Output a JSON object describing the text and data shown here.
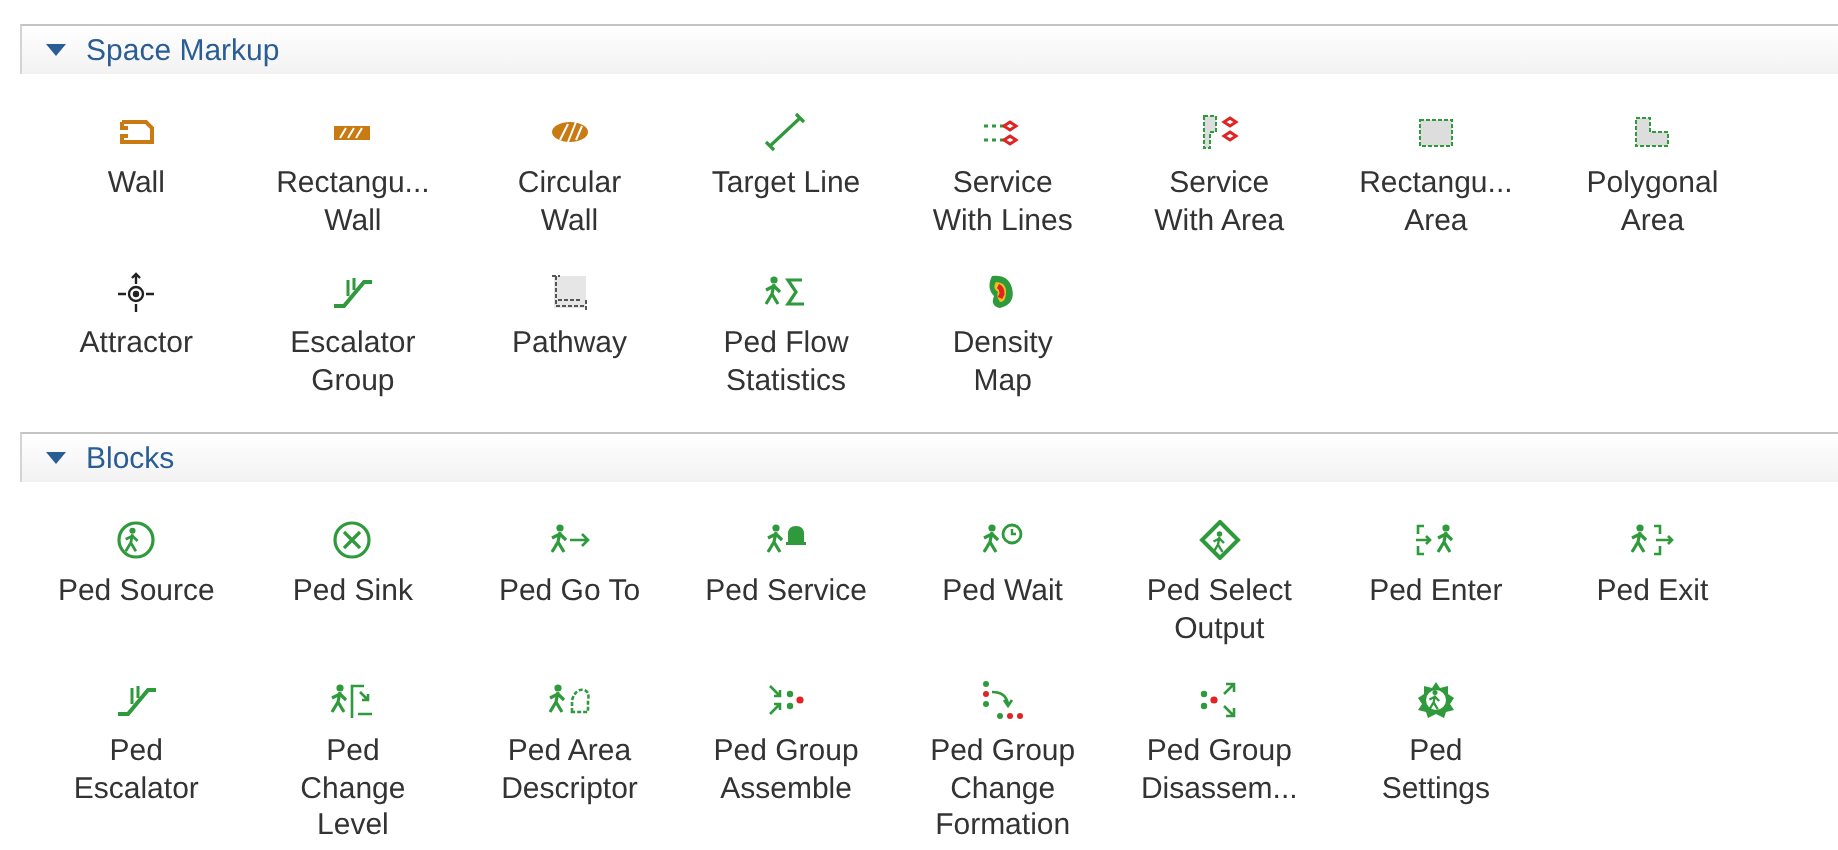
{
  "sections": [
    {
      "title": "Space Markup",
      "expanded": true,
      "items": [
        {
          "label": "Wall",
          "kind": "wall"
        },
        {
          "label": "Rectangu...\nWall",
          "kind": "rect-wall"
        },
        {
          "label": "Circular\nWall",
          "kind": "circ-wall"
        },
        {
          "label": "Target Line",
          "kind": "target-line"
        },
        {
          "label": "Service\nWith Lines",
          "kind": "service-lines"
        },
        {
          "label": "Service\nWith Area",
          "kind": "service-area"
        },
        {
          "label": "Rectangu...\nArea",
          "kind": "rect-area"
        },
        {
          "label": "Polygonal\nArea",
          "kind": "poly-area"
        },
        {
          "label": "Attractor",
          "kind": "attractor"
        },
        {
          "label": "Escalator\nGroup",
          "kind": "escalator"
        },
        {
          "label": "Pathway",
          "kind": "pathway"
        },
        {
          "label": "Ped Flow\nStatistics",
          "kind": "flow-stats"
        },
        {
          "label": "Density\nMap",
          "kind": "density"
        }
      ]
    },
    {
      "title": "Blocks",
      "expanded": true,
      "items": [
        {
          "label": "Ped Source",
          "kind": "source"
        },
        {
          "label": "Ped Sink",
          "kind": "sink"
        },
        {
          "label": "Ped Go To",
          "kind": "goto"
        },
        {
          "label": "Ped Service",
          "kind": "service"
        },
        {
          "label": "Ped Wait",
          "kind": "wait"
        },
        {
          "label": "Ped Select\nOutput",
          "kind": "select"
        },
        {
          "label": "Ped Enter",
          "kind": "enter"
        },
        {
          "label": "Ped Exit",
          "kind": "exit"
        },
        {
          "label": "Ped\nEscalator",
          "kind": "escalator"
        },
        {
          "label": "Ped\nChange\nLevel",
          "kind": "change-level"
        },
        {
          "label": "Ped Area\nDescriptor",
          "kind": "area-descriptor"
        },
        {
          "label": "Ped Group\nAssemble",
          "kind": "assemble"
        },
        {
          "label": "Ped Group\nChange\nFormation",
          "kind": "formation"
        },
        {
          "label": "Ped Group\nDisassem...",
          "kind": "disassemble"
        },
        {
          "label": "Ped\nSettings",
          "kind": "settings"
        }
      ]
    }
  ]
}
